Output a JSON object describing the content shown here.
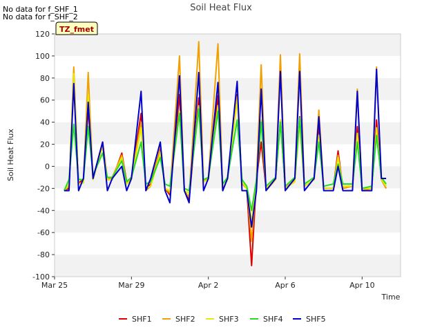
{
  "notes": [
    "No data for f_SHF_1",
    "No data for f_SHF_2"
  ],
  "chart_data": {
    "type": "line",
    "title": "Soil Heat Flux",
    "badge": "TZ_fmet",
    "xlabel": "Time",
    "ylabel": "Soil Heat Flux",
    "xlim": [
      "2024-03-25",
      "2024-04-12"
    ],
    "ylim": [
      -100,
      120
    ],
    "x_ticks": [
      {
        "label": "Mar 25",
        "date": "2024-03-25"
      },
      {
        "label": "Mar 29",
        "date": "2024-03-29"
      },
      {
        "label": "Apr 2",
        "date": "2024-04-02"
      },
      {
        "label": "Apr 6",
        "date": "2024-04-06"
      },
      {
        "label": "Apr 10",
        "date": "2024-04-10"
      }
    ],
    "y_ticks": [
      120,
      100,
      80,
      60,
      40,
      20,
      0,
      -20,
      -40,
      -60,
      -80,
      -100
    ],
    "grid": "horizontal bands",
    "legend_position": "bottom",
    "series": [
      {
        "name": "SHF1",
        "color": "#dd0000",
        "x": [
          "2024-03-25T12:00",
          "2024-03-25T18:00",
          "2024-03-26T00:00",
          "2024-03-26T06:00",
          "2024-03-26T12:00",
          "2024-03-26T18:00",
          "2024-03-27T00:00",
          "2024-03-27T12:00",
          "2024-03-27T18:00",
          "2024-03-28T00:00",
          "2024-03-28T12:00",
          "2024-03-28T18:00",
          "2024-03-29T00:00",
          "2024-03-29T12:00",
          "2024-03-29T18:00",
          "2024-03-30T00:00",
          "2024-03-30T12:00",
          "2024-03-30T18:00",
          "2024-03-31T00:00",
          "2024-03-31T12:00",
          "2024-03-31T18:00",
          "2024-04-01T00:00",
          "2024-04-01T12:00",
          "2024-04-01T18:00",
          "2024-04-02T00:00",
          "2024-04-02T12:00",
          "2024-04-02T18:00",
          "2024-04-03T00:00",
          "2024-04-03T12:00",
          "2024-04-03T18:00",
          "2024-04-04T00:00",
          "2024-04-04T06:00",
          "2024-04-04T12:00",
          "2024-04-04T18:00",
          "2024-04-05T00:00",
          "2024-04-05T12:00",
          "2024-04-05T18:00",
          "2024-04-06T00:00",
          "2024-04-06T12:00",
          "2024-04-06T18:00",
          "2024-04-07T00:00",
          "2024-04-07T12:00",
          "2024-04-07T18:00",
          "2024-04-08T00:00",
          "2024-04-08T12:00",
          "2024-04-08T18:00",
          "2024-04-09T00:00",
          "2024-04-09T12:00",
          "2024-04-09T18:00",
          "2024-04-10T00:00",
          "2024-04-10T12:00",
          "2024-04-10T18:00",
          "2024-04-11T00:00",
          "2024-04-11T06:00"
        ],
        "y": [
          -22,
          -20,
          78,
          -15,
          -12,
          52,
          -11,
          22,
          -12,
          -12,
          12,
          -14,
          -10,
          48,
          -20,
          -16,
          18,
          -20,
          -26,
          65,
          -22,
          -30,
          62,
          -14,
          -10,
          64,
          -22,
          -10,
          65,
          -15,
          -20,
          -90,
          -12,
          22,
          -20,
          -12,
          42,
          -20,
          -12,
          45,
          -18,
          -12,
          38,
          -20,
          -20,
          14,
          -20,
          -18,
          36,
          -22,
          -20,
          42,
          -12,
          -20
        ]
      },
      {
        "name": "SHF2",
        "color": "#f0a000",
        "x": [
          "2024-03-25T12:00",
          "2024-03-25T18:00",
          "2024-03-26T00:00",
          "2024-03-26T06:00",
          "2024-03-26T12:00",
          "2024-03-26T18:00",
          "2024-03-27T00:00",
          "2024-03-27T12:00",
          "2024-03-27T18:00",
          "2024-03-28T00:00",
          "2024-03-28T12:00",
          "2024-03-28T18:00",
          "2024-03-29T00:00",
          "2024-03-29T12:00",
          "2024-03-29T18:00",
          "2024-03-30T00:00",
          "2024-03-30T12:00",
          "2024-03-30T18:00",
          "2024-03-31T00:00",
          "2024-03-31T12:00",
          "2024-03-31T18:00",
          "2024-04-01T00:00",
          "2024-04-01T12:00",
          "2024-04-01T18:00",
          "2024-04-02T00:00",
          "2024-04-02T12:00",
          "2024-04-02T18:00",
          "2024-04-03T00:00",
          "2024-04-03T12:00",
          "2024-04-03T18:00",
          "2024-04-04T00:00",
          "2024-04-04T06:00",
          "2024-04-04T12:00",
          "2024-04-04T18:00",
          "2024-04-05T00:00",
          "2024-04-05T12:00",
          "2024-04-05T18:00",
          "2024-04-06T00:00",
          "2024-04-06T12:00",
          "2024-04-06T18:00",
          "2024-04-07T00:00",
          "2024-04-07T12:00",
          "2024-04-07T18:00",
          "2024-04-08T00:00",
          "2024-04-08T12:00",
          "2024-04-08T18:00",
          "2024-04-09T00:00",
          "2024-04-09T12:00",
          "2024-04-09T18:00",
          "2024-04-10T00:00",
          "2024-04-10T12:00",
          "2024-04-10T18:00",
          "2024-04-11T00:00",
          "2024-04-11T06:00"
        ],
        "y": [
          -22,
          -18,
          90,
          -16,
          -14,
          85,
          -12,
          20,
          -12,
          -10,
          10,
          -15,
          -10,
          40,
          -22,
          -18,
          20,
          -20,
          -24,
          100,
          -22,
          -28,
          113,
          -14,
          -10,
          111,
          -22,
          -10,
          63,
          -16,
          -20,
          -68,
          -12,
          92,
          -22,
          -12,
          101,
          -20,
          -12,
          102,
          -18,
          -12,
          51,
          -20,
          -20,
          10,
          -20,
          -18,
          70,
          -22,
          -20,
          90,
          -12,
          -20
        ]
      },
      {
        "name": "SHF3",
        "color": "#e8e800",
        "x": [
          "2024-03-25T12:00",
          "2024-03-25T18:00",
          "2024-03-26T00:00",
          "2024-03-26T06:00",
          "2024-03-26T12:00",
          "2024-03-26T18:00",
          "2024-03-27T00:00",
          "2024-03-27T12:00",
          "2024-03-27T18:00",
          "2024-03-28T00:00",
          "2024-03-28T12:00",
          "2024-03-28T18:00",
          "2024-03-29T00:00",
          "2024-03-29T12:00",
          "2024-03-29T18:00",
          "2024-03-30T00:00",
          "2024-03-30T12:00",
          "2024-03-30T18:00",
          "2024-03-31T00:00",
          "2024-03-31T12:00",
          "2024-03-31T18:00",
          "2024-04-01T00:00",
          "2024-04-01T12:00",
          "2024-04-01T18:00",
          "2024-04-02T00:00",
          "2024-04-02T12:00",
          "2024-04-02T18:00",
          "2024-04-03T00:00",
          "2024-04-03T12:00",
          "2024-04-03T18:00",
          "2024-04-04T00:00",
          "2024-04-04T06:00",
          "2024-04-04T12:00",
          "2024-04-04T18:00",
          "2024-04-05T00:00",
          "2024-04-05T12:00",
          "2024-04-05T18:00",
          "2024-04-06T00:00",
          "2024-04-06T12:00",
          "2024-04-06T18:00",
          "2024-04-07T00:00",
          "2024-04-07T12:00",
          "2024-04-07T18:00",
          "2024-04-08T00:00",
          "2024-04-08T12:00",
          "2024-04-08T18:00",
          "2024-04-09T00:00",
          "2024-04-09T12:00",
          "2024-04-09T18:00",
          "2024-04-10T00:00",
          "2024-04-10T12:00",
          "2024-04-10T18:00",
          "2024-04-11T00:00",
          "2024-04-11T06:00"
        ],
        "y": [
          -22,
          -16,
          84,
          -16,
          -15,
          65,
          -12,
          18,
          -12,
          -12,
          8,
          -16,
          -12,
          35,
          -20,
          -18,
          12,
          -20,
          -22,
          50,
          -22,
          -24,
          55,
          -14,
          -12,
          55,
          -20,
          -12,
          60,
          -14,
          -20,
          -50,
          -14,
          42,
          -20,
          -12,
          42,
          -20,
          -14,
          40,
          -18,
          -12,
          28,
          -20,
          -20,
          8,
          -18,
          -18,
          30,
          -20,
          -20,
          35,
          -12,
          -18
        ]
      },
      {
        "name": "SHF4",
        "color": "#22dd22",
        "x": [
          "2024-03-25T12:00",
          "2024-03-25T18:00",
          "2024-03-26T00:00",
          "2024-03-26T06:00",
          "2024-03-26T12:00",
          "2024-03-26T18:00",
          "2024-03-27T00:00",
          "2024-03-27T12:00",
          "2024-03-27T18:00",
          "2024-03-28T00:00",
          "2024-03-28T12:00",
          "2024-03-28T18:00",
          "2024-03-29T00:00",
          "2024-03-29T12:00",
          "2024-03-29T18:00",
          "2024-03-30T00:00",
          "2024-03-30T12:00",
          "2024-03-30T18:00",
          "2024-03-31T00:00",
          "2024-03-31T12:00",
          "2024-03-31T18:00",
          "2024-04-01T00:00",
          "2024-04-01T12:00",
          "2024-04-01T18:00",
          "2024-04-02T00:00",
          "2024-04-02T12:00",
          "2024-04-02T18:00",
          "2024-04-03T00:00",
          "2024-04-03T12:00",
          "2024-04-03T18:00",
          "2024-04-04T00:00",
          "2024-04-04T06:00",
          "2024-04-04T12:00",
          "2024-04-04T18:00",
          "2024-04-05T00:00",
          "2024-04-05T12:00",
          "2024-04-05T18:00",
          "2024-04-06T00:00",
          "2024-04-06T12:00",
          "2024-04-06T18:00",
          "2024-04-07T00:00",
          "2024-04-07T12:00",
          "2024-04-07T18:00",
          "2024-04-08T00:00",
          "2024-04-08T12:00",
          "2024-04-08T18:00",
          "2024-04-09T00:00",
          "2024-04-09T12:00",
          "2024-04-09T18:00",
          "2024-04-10T00:00",
          "2024-04-10T12:00",
          "2024-04-10T18:00",
          "2024-04-11T00:00",
          "2024-04-11T06:00"
        ],
        "y": [
          -22,
          -12,
          38,
          -12,
          -12,
          36,
          -8,
          12,
          -10,
          -10,
          5,
          -14,
          -10,
          22,
          -16,
          -14,
          8,
          -16,
          -18,
          48,
          -20,
          -22,
          52,
          -12,
          -10,
          50,
          -16,
          -10,
          42,
          -12,
          -18,
          -40,
          -12,
          40,
          -18,
          -10,
          40,
          -18,
          -10,
          44,
          -16,
          -10,
          22,
          -18,
          -16,
          2,
          -16,
          -16,
          22,
          -20,
          -18,
          28,
          -10,
          -16
        ]
      },
      {
        "name": "SHF5",
        "color": "#0000cc",
        "x": [
          "2024-03-25T12:00",
          "2024-03-25T18:00",
          "2024-03-26T00:00",
          "2024-03-26T06:00",
          "2024-03-26T12:00",
          "2024-03-26T18:00",
          "2024-03-27T00:00",
          "2024-03-27T12:00",
          "2024-03-27T18:00",
          "2024-03-28T00:00",
          "2024-03-28T12:00",
          "2024-03-28T18:00",
          "2024-03-29T00:00",
          "2024-03-29T12:00",
          "2024-03-29T18:00",
          "2024-03-30T00:00",
          "2024-03-30T12:00",
          "2024-03-30T18:00",
          "2024-03-31T00:00",
          "2024-03-31T12:00",
          "2024-03-31T18:00",
          "2024-04-01T00:00",
          "2024-04-01T12:00",
          "2024-04-01T18:00",
          "2024-04-02T00:00",
          "2024-04-02T12:00",
          "2024-04-02T18:00",
          "2024-04-03T00:00",
          "2024-04-03T12:00",
          "2024-04-03T18:00",
          "2024-04-04T00:00",
          "2024-04-04T06:00",
          "2024-04-04T12:00",
          "2024-04-04T18:00",
          "2024-04-05T00:00",
          "2024-04-05T12:00",
          "2024-04-05T18:00",
          "2024-04-06T00:00",
          "2024-04-06T12:00",
          "2024-04-06T18:00",
          "2024-04-07T00:00",
          "2024-04-07T12:00",
          "2024-04-07T18:00",
          "2024-04-08T00:00",
          "2024-04-08T12:00",
          "2024-04-08T18:00",
          "2024-04-09T00:00",
          "2024-04-09T12:00",
          "2024-04-09T18:00",
          "2024-04-10T00:00",
          "2024-04-10T12:00",
          "2024-04-10T18:00",
          "2024-04-11T00:00",
          "2024-04-11T06:00"
        ],
        "y": [
          -22,
          -22,
          75,
          -22,
          -11,
          58,
          -11,
          22,
          -22,
          -11,
          0,
          -22,
          -11,
          68,
          -22,
          -11,
          22,
          -22,
          -33,
          82,
          -22,
          -33,
          85,
          -22,
          -11,
          76,
          -22,
          -11,
          77,
          -22,
          -22,
          -55,
          -22,
          70,
          -22,
          -11,
          86,
          -22,
          -11,
          86,
          -22,
          -11,
          45,
          -22,
          -22,
          0,
          -22,
          -22,
          68,
          -22,
          -22,
          88,
          -11,
          -11
        ]
      }
    ]
  }
}
